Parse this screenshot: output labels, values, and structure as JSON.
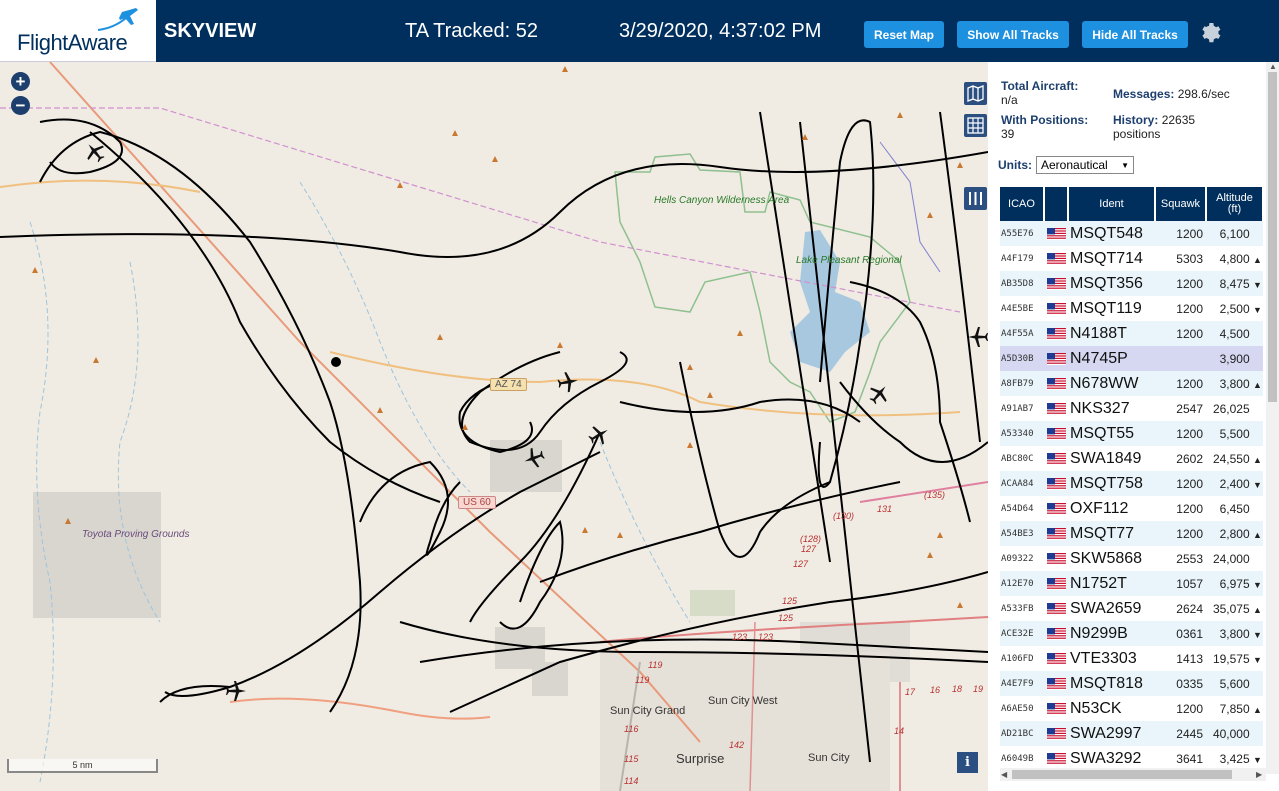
{
  "header": {
    "logo_text": "FlightAware",
    "title": "SKYVIEW",
    "tracked": "TA Tracked: 52",
    "clock": "3/29/2020, 4:37:02 PM",
    "buttons": {
      "reset": "Reset Map",
      "show_all": "Show All Tracks",
      "hide_all": "Hide All Tracks"
    },
    "bg_color": "#002f5d",
    "button_color": "#1e90e0"
  },
  "map": {
    "zoom_in": "+",
    "zoom_out": "−",
    "scale": "5 nm",
    "info": "i",
    "labels": {
      "hells_canyon": "Hells Canyon Wilderness Area",
      "lake_pleasant": "Lake Pleasant Regional",
      "toyota": "Toyota Proving Grounds",
      "az74": "AZ 74",
      "us60": "US 60",
      "sun_city_grand": "Sun City Grand",
      "sun_city_west": "Sun City West",
      "surprise": "Surprise",
      "sun_city": "Sun City",
      "r119a": "119",
      "r119b": "119",
      "r116": "116",
      "r115": "115",
      "r114": "114",
      "r142": "142",
      "r123a": "123",
      "r123b": "123",
      "r125a": "125",
      "r125b": "125",
      "r127a": "127",
      "r127b": "127",
      "r128": "(128)",
      "r130": "(130)",
      "r131": "131",
      "r135": "(135)",
      "r17": "17",
      "r16": "16",
      "r18": "18",
      "r19": "19",
      "r14": "14"
    }
  },
  "sidebar": {
    "total_aircraft_label": "Total Aircraft:",
    "total_aircraft_value": "n/a",
    "messages_label": "Messages:",
    "messages_value": "298.6/sec",
    "with_positions_label": "With Positions:",
    "with_positions_value": "39",
    "history_label": "History:",
    "history_value": "22635",
    "history_unit": "positions",
    "units_label": "Units:",
    "units_value": "Aeronautical",
    "columns": {
      "icao": "ICAO",
      "ident": "Ident",
      "squawk": "Squawk",
      "altitude": "Altitude",
      "altitude_unit": "(ft)"
    },
    "rows": [
      {
        "icao": "A55E76",
        "ident": "MSQT548",
        "squawk": "1200",
        "alt": "6,100",
        "arrow": ""
      },
      {
        "icao": "A4F179",
        "ident": "MSQT714",
        "squawk": "5303",
        "alt": "4,800",
        "arrow": "▲"
      },
      {
        "icao": "AB35D8",
        "ident": "MSQT356",
        "squawk": "1200",
        "alt": "8,475",
        "arrow": "▼"
      },
      {
        "icao": "A4E5BE",
        "ident": "MSQT119",
        "squawk": "1200",
        "alt": "2,500",
        "arrow": "▼"
      },
      {
        "icao": "A4F55A",
        "ident": "N4188T",
        "squawk": "1200",
        "alt": "4,500",
        "arrow": ""
      },
      {
        "icao": "A5D30B",
        "ident": "N4745P",
        "squawk": "",
        "alt": "3,900",
        "arrow": "",
        "selected": true
      },
      {
        "icao": "A8FB79",
        "ident": "N678WW",
        "squawk": "1200",
        "alt": "3,800",
        "arrow": "▲"
      },
      {
        "icao": "A91AB7",
        "ident": "NKS327",
        "squawk": "2547",
        "alt": "26,025",
        "arrow": ""
      },
      {
        "icao": "A53340",
        "ident": "MSQT55",
        "squawk": "1200",
        "alt": "5,500",
        "arrow": ""
      },
      {
        "icao": "ABC80C",
        "ident": "SWA1849",
        "squawk": "2602",
        "alt": "24,550",
        "arrow": "▲"
      },
      {
        "icao": "ACAA84",
        "ident": "MSQT758",
        "squawk": "1200",
        "alt": "2,400",
        "arrow": "▼"
      },
      {
        "icao": "A54D64",
        "ident": "OXF112",
        "squawk": "1200",
        "alt": "6,450",
        "arrow": ""
      },
      {
        "icao": "A54BE3",
        "ident": "MSQT77",
        "squawk": "1200",
        "alt": "2,800",
        "arrow": "▲"
      },
      {
        "icao": "A09322",
        "ident": "SKW5868",
        "squawk": "2553",
        "alt": "24,000",
        "arrow": ""
      },
      {
        "icao": "A12E70",
        "ident": "N1752T",
        "squawk": "1057",
        "alt": "6,975",
        "arrow": "▼"
      },
      {
        "icao": "A533FB",
        "ident": "SWA2659",
        "squawk": "2624",
        "alt": "35,075",
        "arrow": "▲"
      },
      {
        "icao": "ACE32E",
        "ident": "N9299B",
        "squawk": "0361",
        "alt": "3,800",
        "arrow": "▼"
      },
      {
        "icao": "A106FD",
        "ident": "VTE3303",
        "squawk": "1413",
        "alt": "19,575",
        "arrow": "▼"
      },
      {
        "icao": "A4E7F9",
        "ident": "MSQT818",
        "squawk": "0335",
        "alt": "5,600",
        "arrow": ""
      },
      {
        "icao": "A6AE50",
        "ident": "N53CK",
        "squawk": "1200",
        "alt": "7,850",
        "arrow": "▲"
      },
      {
        "icao": "AD21BC",
        "ident": "SWA2997",
        "squawk": "2445",
        "alt": "40,000",
        "arrow": ""
      },
      {
        "icao": "A6049B",
        "ident": "SWA3292",
        "squawk": "3641",
        "alt": "3,425",
        "arrow": "▼"
      }
    ]
  }
}
